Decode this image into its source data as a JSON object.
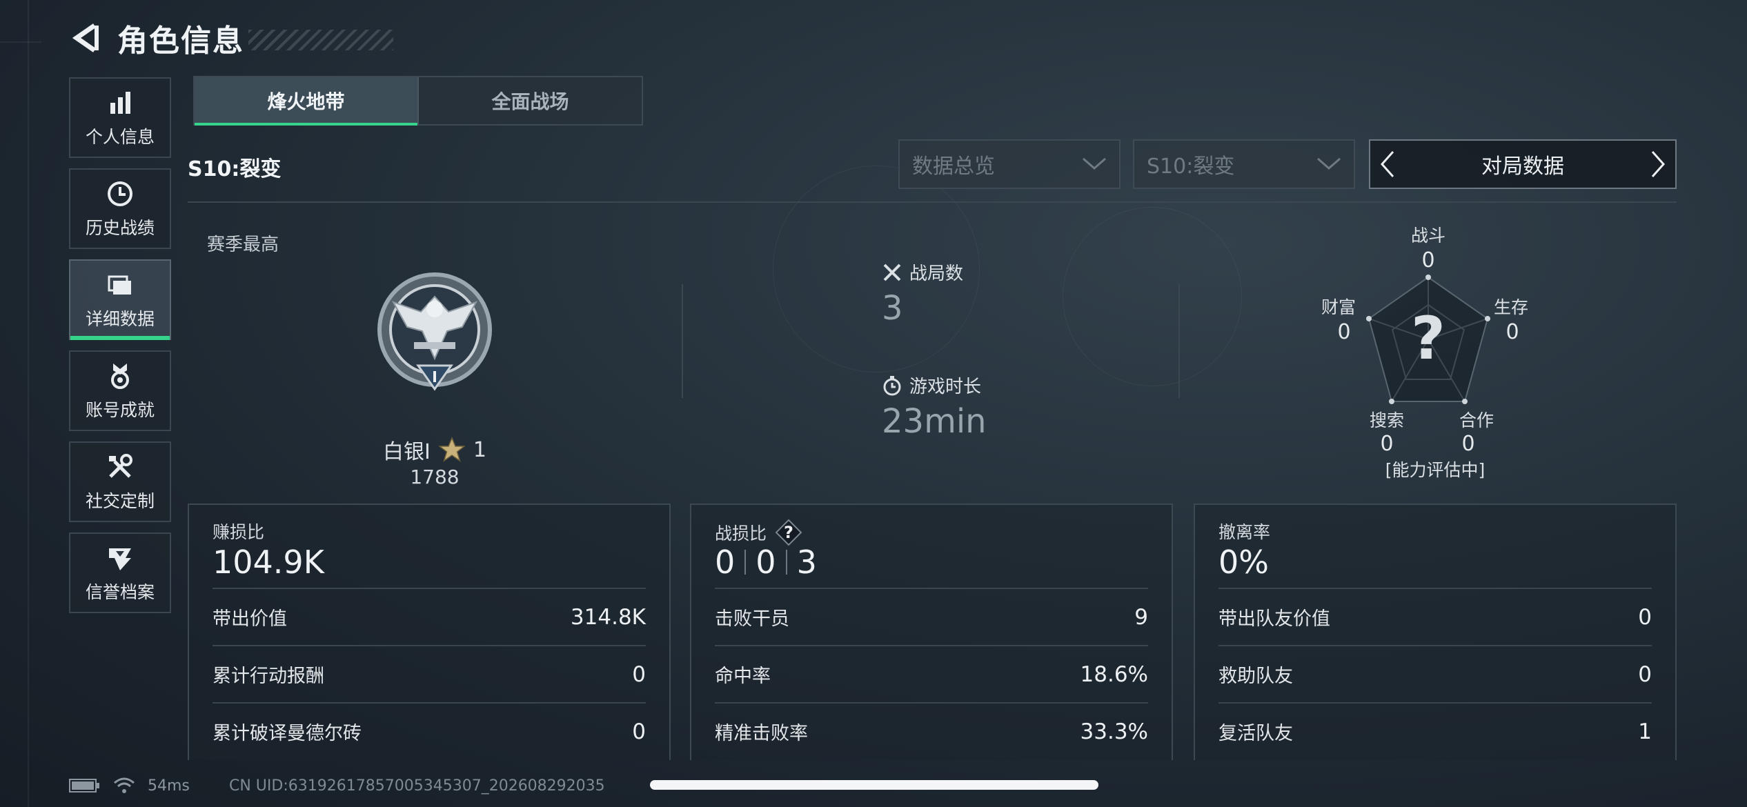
{
  "header": {
    "title": "角色信息"
  },
  "sidebar": {
    "items": [
      {
        "label": "个人信息",
        "icon": "bar-chart-icon"
      },
      {
        "label": "历史战绩",
        "icon": "clock-icon"
      },
      {
        "label": "详细数据",
        "icon": "folders-icon",
        "active": true
      },
      {
        "label": "账号成就",
        "icon": "medal-icon"
      },
      {
        "label": "社交定制",
        "icon": "tools-icon"
      },
      {
        "label": "信誉档案",
        "icon": "emblem-icon"
      }
    ]
  },
  "tabs": [
    {
      "label": "烽火地带",
      "active": true
    },
    {
      "label": "全面战场",
      "active": false
    }
  ],
  "season_label": "S10:裂变",
  "filters": {
    "data_scope": "数据总览",
    "season": "S10:裂变",
    "view": "对局数据"
  },
  "season_best": {
    "label": "赛季最高",
    "rank_name": "白银I",
    "stars": "1",
    "score": "1788"
  },
  "summary": {
    "matches_label": "战局数",
    "matches_value": "3",
    "playtime_label": "游戏时长",
    "playtime_value": "23min"
  },
  "radar": {
    "axes": [
      {
        "label": "战斗",
        "value": "0"
      },
      {
        "label": "生存",
        "value": "0"
      },
      {
        "label": "合作",
        "value": "0"
      },
      {
        "label": "搜索",
        "value": "0"
      },
      {
        "label": "财富",
        "value": "0"
      }
    ],
    "center_mark": "?",
    "status": "[能力评估中]"
  },
  "panels": {
    "profit": {
      "label": "赚损比",
      "value": "104.9K",
      "rows": [
        {
          "label": "带出价值",
          "value": "314.8K"
        },
        {
          "label": "累计行动报酬",
          "value": "0"
        },
        {
          "label": "累计破译曼德尔砖",
          "value": "0"
        }
      ]
    },
    "combat": {
      "label": "战损比",
      "help": "?",
      "kd": [
        "0",
        "0",
        "3"
      ],
      "rows": [
        {
          "label": "击败干员",
          "value": "9"
        },
        {
          "label": "命中率",
          "value": "18.6%"
        },
        {
          "label": "精准击败率",
          "value": "33.3%"
        }
      ]
    },
    "extract": {
      "label": "撤离率",
      "value": "0%",
      "rows": [
        {
          "label": "带出队友价值",
          "value": "0"
        },
        {
          "label": "救助队友",
          "value": "0"
        },
        {
          "label": "复活队友",
          "value": "1"
        }
      ]
    }
  },
  "status_bar": {
    "ping": "54ms",
    "uid": "CN UID:63192617857005345307_202608292035"
  },
  "colors": {
    "accent": "#36d48a",
    "background": "#1f2932"
  }
}
